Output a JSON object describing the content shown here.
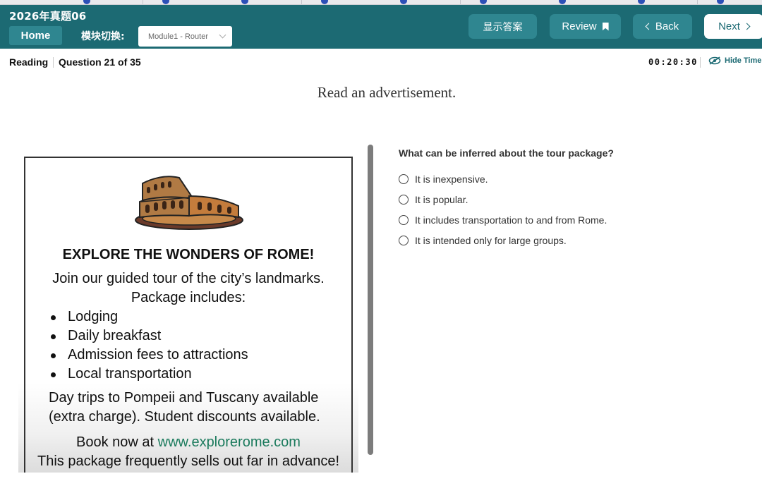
{
  "header": {
    "exam_title": "2026年真题06",
    "home_label": "Home",
    "module_label": "模块切换:",
    "module_selected": "Module1 - Router",
    "show_answer_label": "显示答案",
    "review_label": "Review",
    "back_label": "Back",
    "next_label": "Next"
  },
  "status": {
    "section": "Reading",
    "question_counter": "Question 21 of 35",
    "timer": "00:20:30",
    "hide_time_label": "Hide Time"
  },
  "instruction": "Read an advertisement.",
  "advertisement": {
    "heading": "EXPLORE THE WONDERS OF ROME!",
    "intro_line1": "Join our guided tour of the city’s landmarks.",
    "intro_line2": "Package includes:",
    "includes": [
      "Lodging",
      "Daily breakfast",
      "Admission fees to attractions",
      "Local transportation"
    ],
    "extra_line1": "Day trips to Pompeii and Tuscany available",
    "extra_line2": "(extra charge). Student discounts available.",
    "book_prefix": "Book now at ",
    "book_url": "www.explorerome.com",
    "sells_out": "This package frequently sells out far in advance!"
  },
  "question": {
    "stem": "What can be inferred about the tour package?",
    "choices": [
      "It is inexpensive.",
      "It is popular.",
      "It includes transportation to and from Rome.",
      "It is intended only for large groups."
    ]
  },
  "colors": {
    "header_bg": "#1c6a73",
    "button_bg": "#2f8690",
    "url_green": "#1a7a5c"
  }
}
